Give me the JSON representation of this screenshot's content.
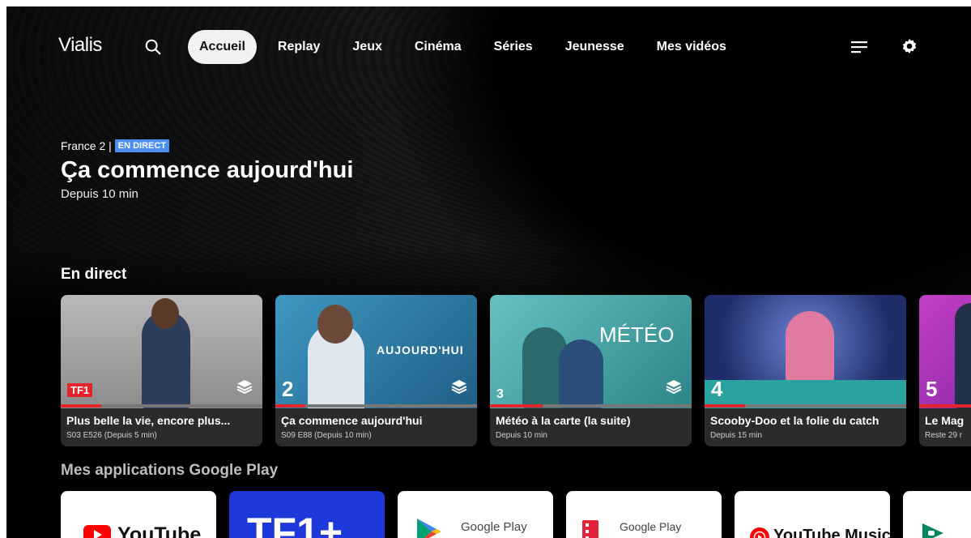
{
  "app": {
    "logo": "Vialis"
  },
  "nav": {
    "items": [
      {
        "label": "Accueil",
        "active": true
      },
      {
        "label": "Replay"
      },
      {
        "label": "Jeux"
      },
      {
        "label": "Cinéma"
      },
      {
        "label": "Séries"
      },
      {
        "label": "Jeunesse"
      },
      {
        "label": "Mes vidéos"
      }
    ],
    "icons": [
      "search-icon",
      "menu-icon",
      "gear-icon"
    ]
  },
  "hero": {
    "channel": "France 2 |",
    "badge": "EN DIRECT",
    "title": "Ça commence aujourd'hui",
    "subtitle": "Depuis 10 min"
  },
  "live_section": {
    "title": "En direct",
    "cards": [
      {
        "channel_logo": "TF1",
        "title": "Plus belle la vie, encore plus...",
        "meta": "S03 E526 (Depuis 5 min)",
        "progress": 0.2,
        "thumb_color": "#9a9a9a",
        "overlay_text": ""
      },
      {
        "channel_logo": "2",
        "title": "Ça commence aujourd'hui",
        "meta": "S09 E88 (Depuis 10 min)",
        "progress": 0.15,
        "thumb_color": "#2f7da6",
        "overlay_text": "AUJOURD'HUI"
      },
      {
        "channel_logo": "3",
        "title": "Météo à la carte (la suite)",
        "meta": "Depuis 10 min",
        "progress": 0.26,
        "thumb_color": "#4aa6a8",
        "overlay_text": "MÉTÉO"
      },
      {
        "channel_logo": "4",
        "title": "Scooby-Doo et la folie du catch",
        "meta": "Depuis 15 min",
        "progress": 0.2,
        "thumb_color": "#3c5aa8",
        "overlay_text": ""
      },
      {
        "channel_logo": "5",
        "title": "Le Mag",
        "meta": "Reste 29 r",
        "progress": 0.3,
        "thumb_color": "#b03ab8",
        "overlay_text": ""
      }
    ]
  },
  "apps_section": {
    "title": "Mes applications Google Play",
    "apps": [
      {
        "label": "YouTube",
        "bg": "#ffffff"
      },
      {
        "label": "TF1+",
        "bg": "#1e38d9"
      },
      {
        "label": "Google Play",
        "bg": "#ffffff"
      },
      {
        "label": "Google Play",
        "bg": "#ffffff"
      },
      {
        "label": "YouTube Music",
        "bg": "#ffffff"
      },
      {
        "label": "",
        "bg": "#ffffff"
      }
    ]
  }
}
